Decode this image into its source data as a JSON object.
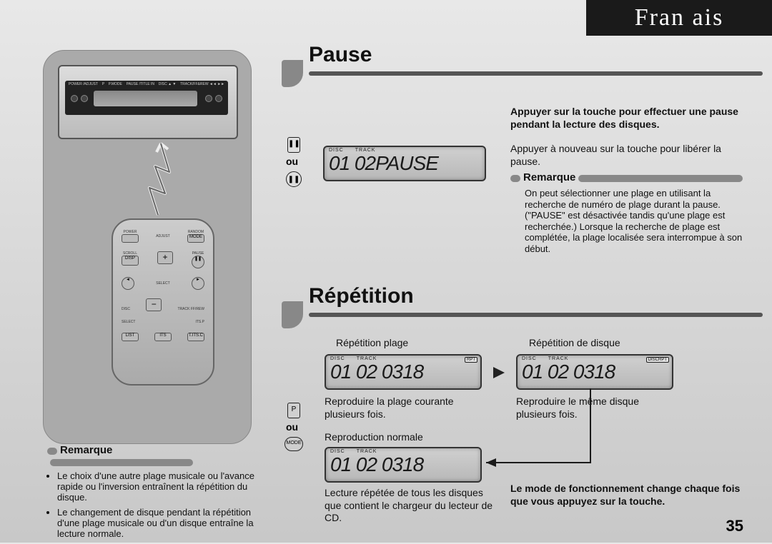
{
  "language_tab": "Fran   ais",
  "page_number": "35",
  "left": {
    "head_unit_labels": [
      "POWER /ADJUST",
      "P",
      "P.MODE",
      "PAUSE /TITLE IN",
      "DISC ▲ ▼",
      "TRACK/FF&REW ◄◄ ►►"
    ],
    "remote_labels": {
      "power": "POWER",
      "adjust": "ADJUST",
      "random": "RANDOM",
      "mode": "MODE",
      "scroll": "SCROLL",
      "disp": "DISP",
      "pause": "PAUSE",
      "plus": "+",
      "minus": "−",
      "left": "◄",
      "right": "►",
      "select": "SELECT",
      "disc": "DISC",
      "track": "TRACK FF/REW",
      "select2": "SELECT",
      "itsp": "ITS.P",
      "list": "LIST",
      "its": "ITS",
      "itsc": "T.ITS.C"
    },
    "remark_title": "Remarque",
    "remark_items": [
      "Le choix d'une autre plage musicale ou l'avance rapide ou l'inversion entraînent la répétition du disque.",
      "Le changement de disque pendant la répétition d'une plage musicale ou d'un disque entraîne la lecture normale."
    ]
  },
  "pause": {
    "title": "Pause",
    "cue1": "❚❚",
    "ou": "ou",
    "cue2": "❚❚",
    "lcd_top_disc": "DISC",
    "lcd_top_track": "TRACK",
    "lcd_text": "01 02PAUSE",
    "instr_bold": "Appuyer sur la touche pour effectuer une pause pendant la lecture des disques.",
    "instr_plain": "Appuyer à nouveau sur la touche pour libérer la pause.",
    "remark_title": "Remarque",
    "remark_body": "On peut sélectionner une plage en utilisant la recherche de numéro de plage durant la pause. (\"PAUSE\" est désactivée tandis qu'une plage est recherchée.) Lorsque la recherche de plage est complétée, la plage localisée sera interrompue à son début."
  },
  "repetition": {
    "title": "Répétition",
    "cue1": "P",
    "ou": "ou",
    "cue2": "MODE",
    "track_label": "Répétition plage",
    "disc_label": "Répétition de disque",
    "lcd1": {
      "disc": "DISC",
      "track": "TRACK",
      "badge": "RPT",
      "text": "01 02 0318"
    },
    "lcd2": {
      "disc": "DISC",
      "track": "TRACK",
      "badge": "DISCRPT",
      "text": "01 02 0318"
    },
    "lcd3": {
      "disc": "DISC",
      "track": "TRACK",
      "text": "01 02 0318"
    },
    "caption1": "Reproduire la plage courante plusieurs fois.",
    "caption2": "Reproduire le même disque plusieurs fois.",
    "normal_label": "Reproduction normale",
    "caption3_a": "Lecture répétée de tous les disques que contient le chargeur du lecteur de CD.",
    "mode_text": "Le mode de fonctionnement change chaque fois que vous appuyez sur la touche."
  }
}
